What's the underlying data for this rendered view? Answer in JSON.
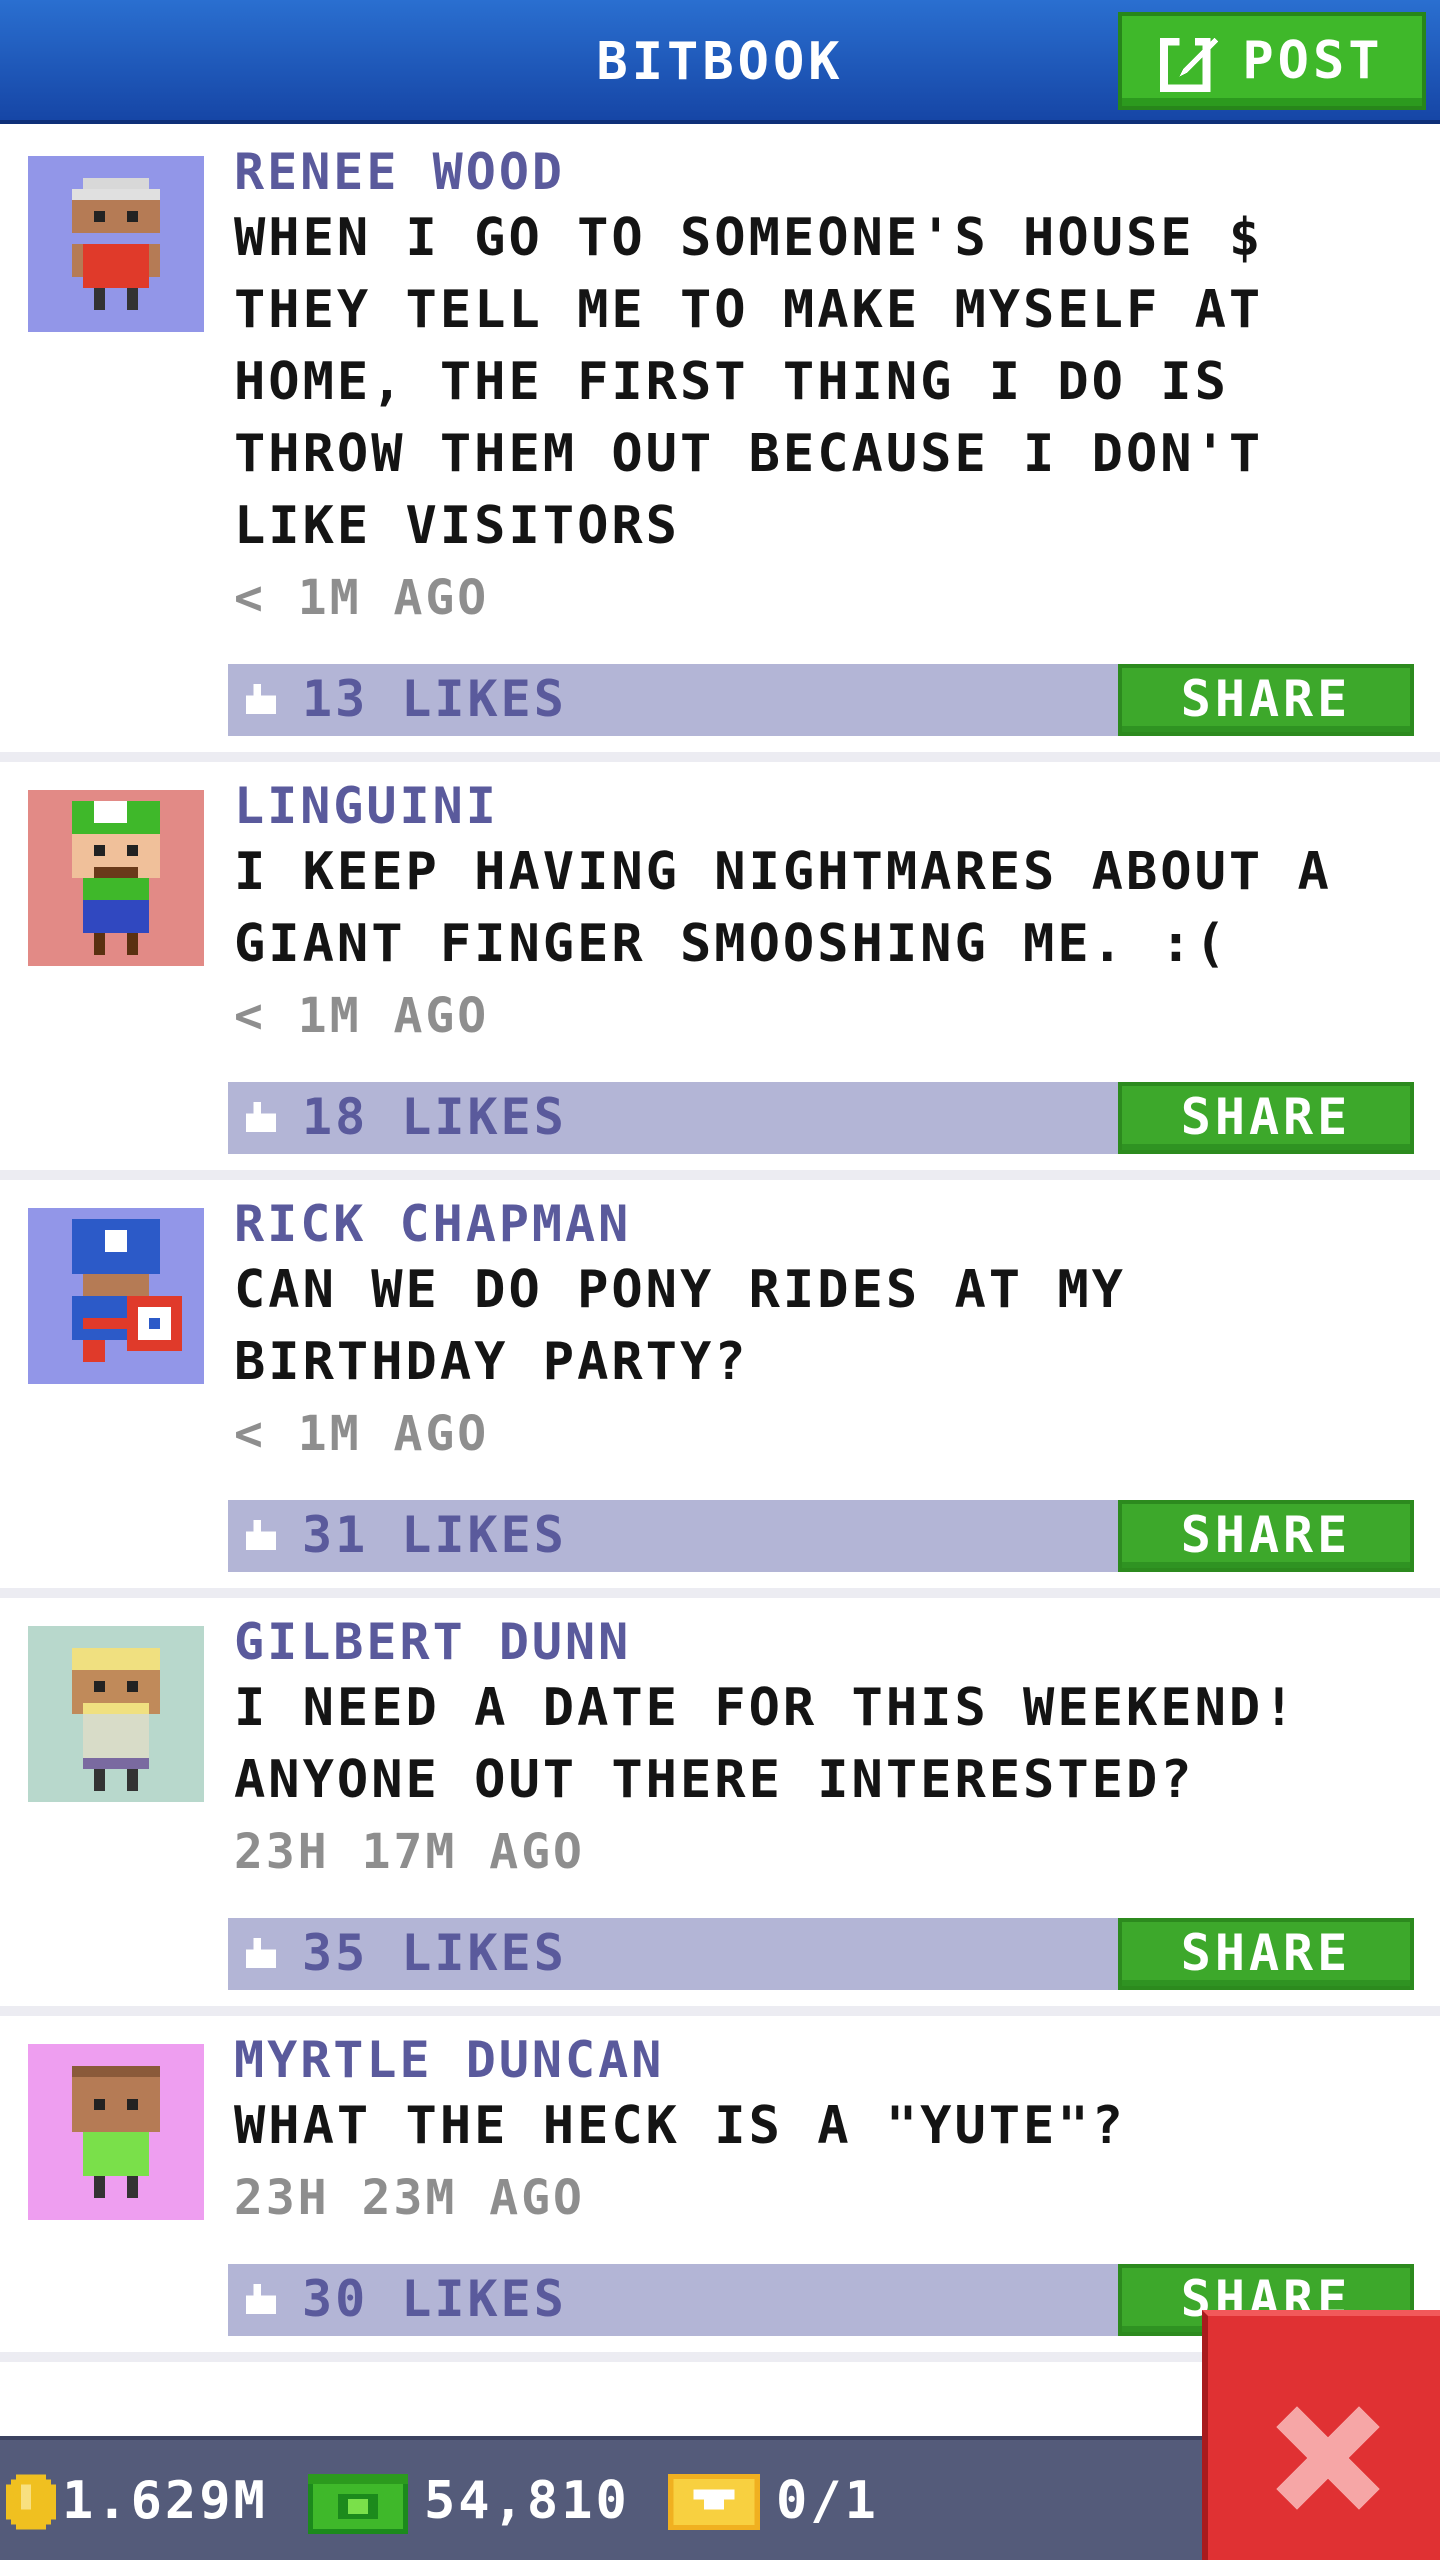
{
  "header": {
    "title": "BITBOOK",
    "post_label": "POST"
  },
  "posts": [
    {
      "author": "RENEE WOOD",
      "text": " WHEN I GO TO SOMEONE'S HOUSE $ THEY TELL ME TO MAKE MYSELF AT HOME, THE FIRST THING I DO IS THROW THEM OUT BECAUSE I DON'T LIKE VISITORS",
      "time": "< 1M AGO",
      "likes": "13 LIKES",
      "share": "SHARE",
      "avatar_bg": "#9296e8"
    },
    {
      "author": "LINGUINI",
      "text": "I KEEP HAVING NIGHTMARES ABOUT A GIANT FINGER SMOOSHING ME. :(",
      "time": "< 1M AGO",
      "likes": "18 LIKES",
      "share": "SHARE",
      "avatar_bg": "#e28a86"
    },
    {
      "author": "RICK CHAPMAN",
      "text": "CAN WE DO PONY RIDES AT MY BIRTHDAY PARTY?",
      "time": "< 1M AGO",
      "likes": "31 LIKES",
      "share": "SHARE",
      "avatar_bg": "#9296e8"
    },
    {
      "author": "GILBERT DUNN",
      "text": "I NEED A DATE FOR THIS WEEKEND! ANYONE OUT THERE INTERESTED?",
      "time": "23H 17M AGO",
      "likes": "35 LIKES",
      "share": "SHARE",
      "avatar_bg": "#b8d8cc"
    },
    {
      "author": "MYRTLE DUNCAN",
      "text": "WHAT THE HECK IS A \"YUTE\"?",
      "time": "23H 23M AGO",
      "likes": "30 LIKES",
      "share": "SHARE",
      "avatar_bg": "#ee9ef0"
    }
  ],
  "stats": {
    "coins": "1.629M",
    "bux": "54,810",
    "tickets": "0/1"
  },
  "colors": {
    "header": "#1c54b8",
    "post_button": "#3fb82a",
    "share_button": "#3da82b",
    "like_bar": "#b3b5d6",
    "bottom_bar": "#545b7a",
    "close": "#e03133"
  },
  "icons": [
    "post-edit-icon",
    "like-icon",
    "coin-icon",
    "bux-icon",
    "ticket-icon",
    "close-icon"
  ]
}
